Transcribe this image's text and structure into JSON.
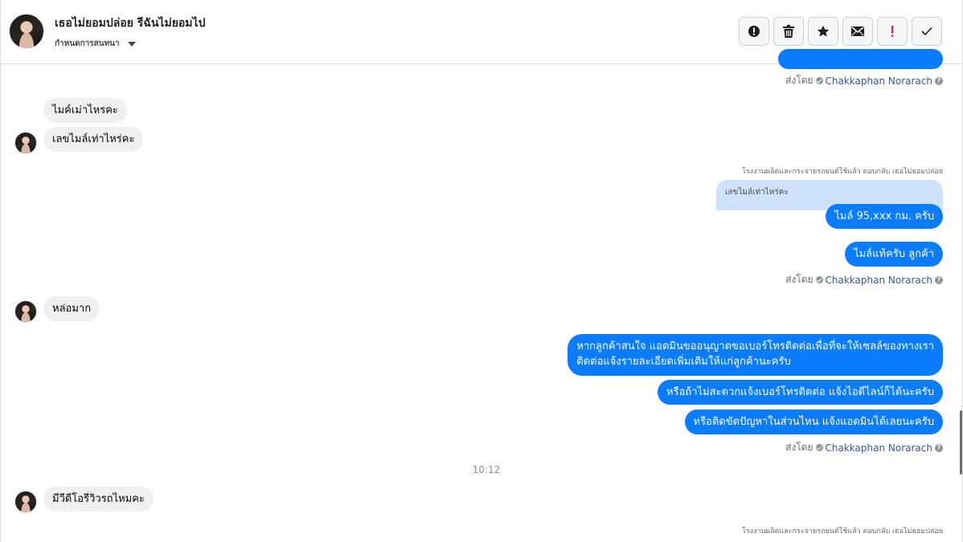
{
  "header": {
    "title": "เธอไม่ยอมปล่อย รีฉันไม่ยอมไป",
    "subtitle": "กำหนดการสนทนา",
    "toolbar": [
      {
        "name": "alert-circle-button",
        "icon": "alert-circle-icon"
      },
      {
        "name": "delete-button",
        "icon": "trash-icon"
      },
      {
        "name": "star-button",
        "icon": "star-icon"
      },
      {
        "name": "mail-button",
        "icon": "envelope-icon"
      },
      {
        "name": "mark-important-button",
        "icon": "exclamation-icon",
        "color": "#e41e3f"
      },
      {
        "name": "done-button",
        "icon": "check-icon"
      }
    ]
  },
  "sent_by": {
    "prefix": "ส่งโดย",
    "name": "Chakkaphan Norarach",
    "help": "?"
  },
  "messages": {
    "in1": "ไมค์เม่าไหรคะ",
    "in2": "เลขไมล์เท่าไหร่คะ",
    "reply_note": "โรงงานผลิตและกระจายรถยนต์ใช้แล้ว ตอบกลับ เธอไม่ยอมปล่อย",
    "quoted": "เลขไมล์เท่าไหร่คะ",
    "out1": "ไมล์ 95,xxx กม. ครับ",
    "out2": "ไมล์แท้ครับ ลูกค้า",
    "in3": "หล่อมาก",
    "out3_line1": "หากลูกค้าสนใจ แอดมินขออนุญาตขอเบอร์โทรติดต่อเพื่อที่จะให้เซลล์ของทางเรา",
    "out3_line2": "ติดต่อแจ้งรายละเอียดเพิ่มเติมให้แก่ลูกค้านะครับ",
    "out4": "หรือถ้าไม่สะดวกแจ้งเบอร์โทรติดต่อ แจ้งไอดีไลน์ก็ได้นะครับ",
    "out5": "หรือติดขัดปัญหาในส่วนไหน แจ้งแอดมินได้เลยนะครับ",
    "time": "10:12",
    "in4": "มีวีดีโอรีวิวรถไหมคะ",
    "reply_note2": "โรงงานผลิตและกระจายรถยนต์ใช้แล้ว ตอบกลับ เธอไม่ยอมปล่อย"
  },
  "colors": {
    "outgoing": "#0a7cff",
    "incoming": "#f0f0f0",
    "link": "#385898",
    "important": "#e41e3f"
  }
}
